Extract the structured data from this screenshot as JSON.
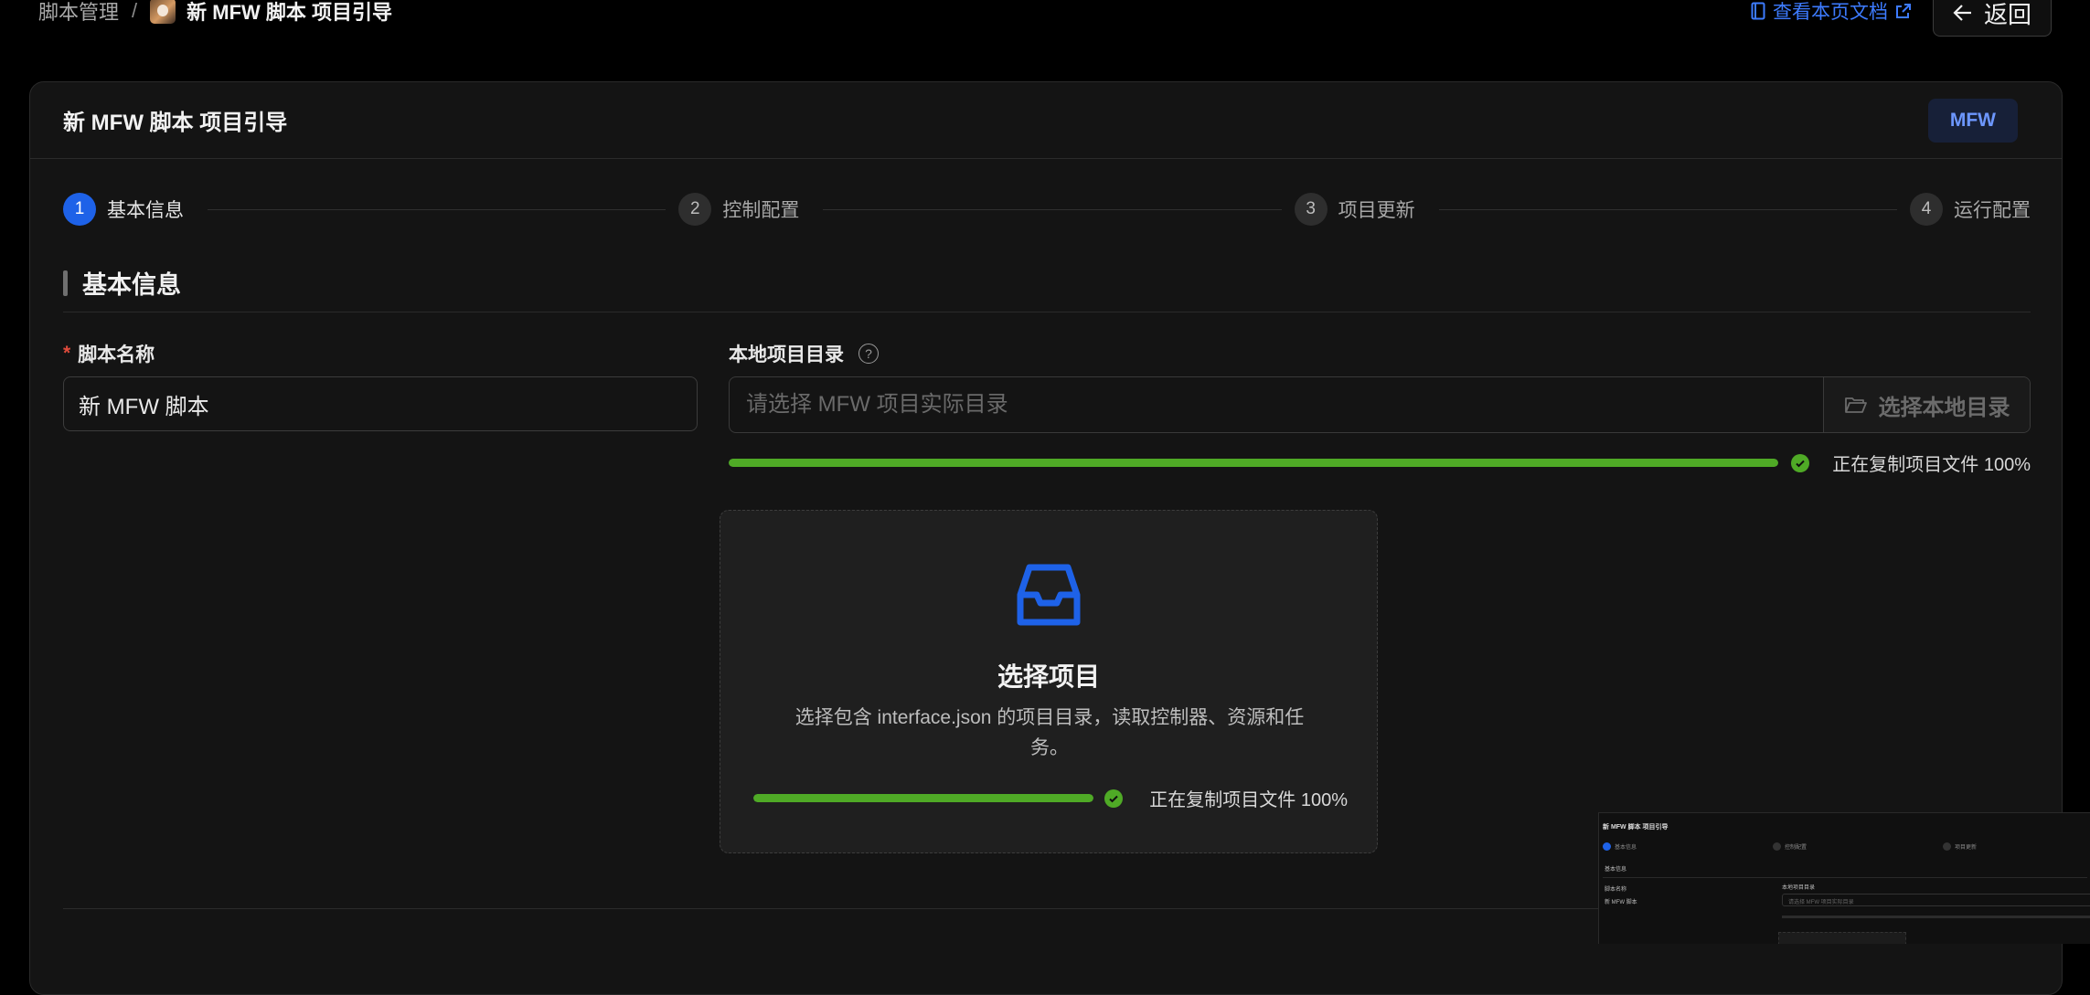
{
  "breadcrumb": {
    "parent": "脚本管理",
    "separator": "/",
    "current": "新 MFW 脚本 项目引导"
  },
  "header_actions": {
    "doc_link": "查看本页文档",
    "back_button": "返回"
  },
  "card": {
    "title": "新 MFW 脚本 项目引导",
    "tag": "MFW"
  },
  "steps": [
    {
      "num": "1",
      "label": "基本信息",
      "active": true
    },
    {
      "num": "2",
      "label": "控制配置",
      "active": false
    },
    {
      "num": "3",
      "label": "项目更新",
      "active": false
    },
    {
      "num": "4",
      "label": "运行配置",
      "active": false
    }
  ],
  "section": {
    "title": "基本信息"
  },
  "form": {
    "name_label": "脚本名称",
    "name_value": "新 MFW 脚本",
    "dir_label": "本地项目目录",
    "dir_placeholder": "请选择 MFW 项目实际目录",
    "dir_button": "选择本地目录",
    "help_icon": "?"
  },
  "progress_top": {
    "value": 1.0,
    "text": "正在复制项目文件 100%"
  },
  "dropzone": {
    "title": "选择项目",
    "description": "选择包含 interface.json 的项目目录，读取控制器、资源和任务。",
    "progress_value": 1.0,
    "progress_text": "正在复制项目文件 100%"
  },
  "mini_preview": {
    "title": "新 MFW 脚本 项目引导",
    "step1": "基本信息",
    "step2": "控制配置",
    "step3": "项目更新",
    "section": "基本信息",
    "name_label": "脚本名称",
    "name_value": "新 MFW 脚本",
    "dir_label": "本地项目目录",
    "dir_placeholder": "请选择 MFW 项目实际目录"
  },
  "colors": {
    "accent": "#1e62e8",
    "link": "#3d7bff",
    "success": "#4faa26",
    "required": "#e04b3c",
    "tag_bg": "#172038",
    "tag_text": "#6d97ff"
  },
  "icons": {
    "doc": "document-icon",
    "external": "external-link-icon",
    "back": "arrow-left-icon",
    "folder": "folder-open-icon",
    "inbox": "inbox-icon",
    "check": "check-circle-icon"
  }
}
